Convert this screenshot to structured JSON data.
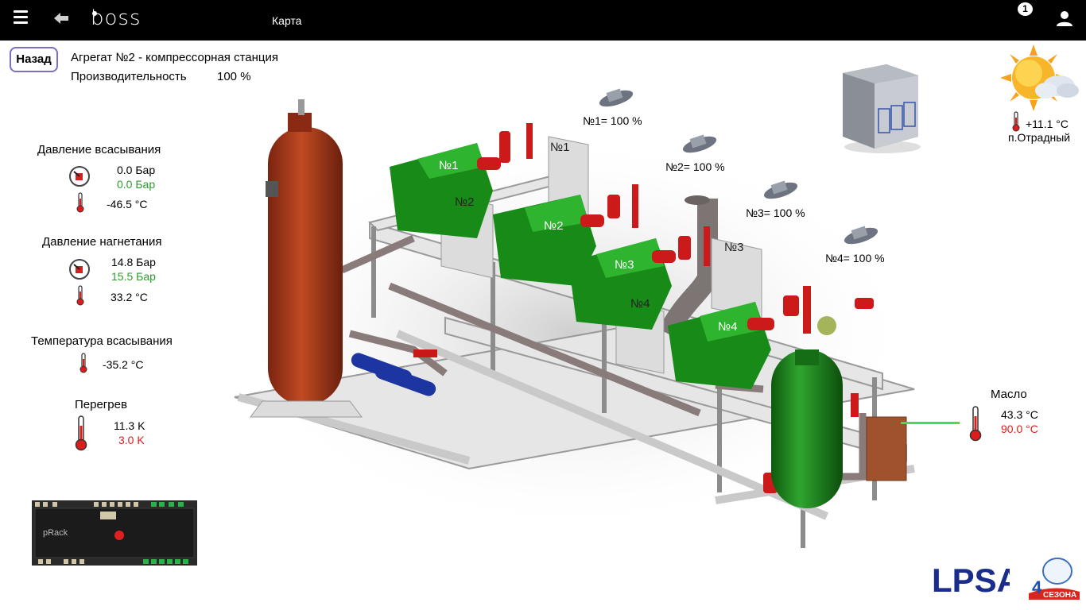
{
  "header": {
    "logo": "boss",
    "title": "Карта",
    "notification_count": "1"
  },
  "nav": {
    "back_label": "Назад"
  },
  "unit": {
    "title": "Агрегат №2 - компрессорная станция",
    "performance_label": "Производительность",
    "performance_value": "100 %"
  },
  "suction_pressure": {
    "label": "Давление всасывания",
    "value": "0.0 Бар",
    "setpoint": "0.0 Бар",
    "temperature": "-46.5 °C"
  },
  "discharge_pressure": {
    "label": "Давление нагнетания",
    "value": "14.8 Бар",
    "setpoint": "15.5 Бар",
    "temperature": "33.2 °C"
  },
  "suction_temperature": {
    "label": "Температура всасывания",
    "value": "-35.2 °C"
  },
  "superheat": {
    "label": "Перегрев",
    "value": "11.3 K",
    "setpoint": "3.0 K"
  },
  "compressors": [
    {
      "label": "№1= 100 %",
      "tag": "№1",
      "box": "№1"
    },
    {
      "label": "№2= 100 %",
      "tag": "№2",
      "box": "№2"
    },
    {
      "label": "№3= 100 %",
      "tag": "№3",
      "box": "№3"
    },
    {
      "label": "№4= 100 %",
      "tag": "№4",
      "box": "№4"
    }
  ],
  "oil": {
    "label": "Масло",
    "value": "43.3 °C",
    "setpoint": "90.0 °C"
  },
  "weather": {
    "temperature": "+11.1 °C",
    "location": "п.Отрадный"
  },
  "controller": {
    "brand": "pRack"
  },
  "logos": {
    "lpsa": "LPSA",
    "brand_number": "4",
    "brand_text": "СЕЗОНА"
  },
  "colors": {
    "ok": "#2e9b2e",
    "alarm": "#e01b1b",
    "compressor": "#1e8a1e",
    "receiver": "#a83a1c",
    "frame": "#e5e5e5"
  }
}
